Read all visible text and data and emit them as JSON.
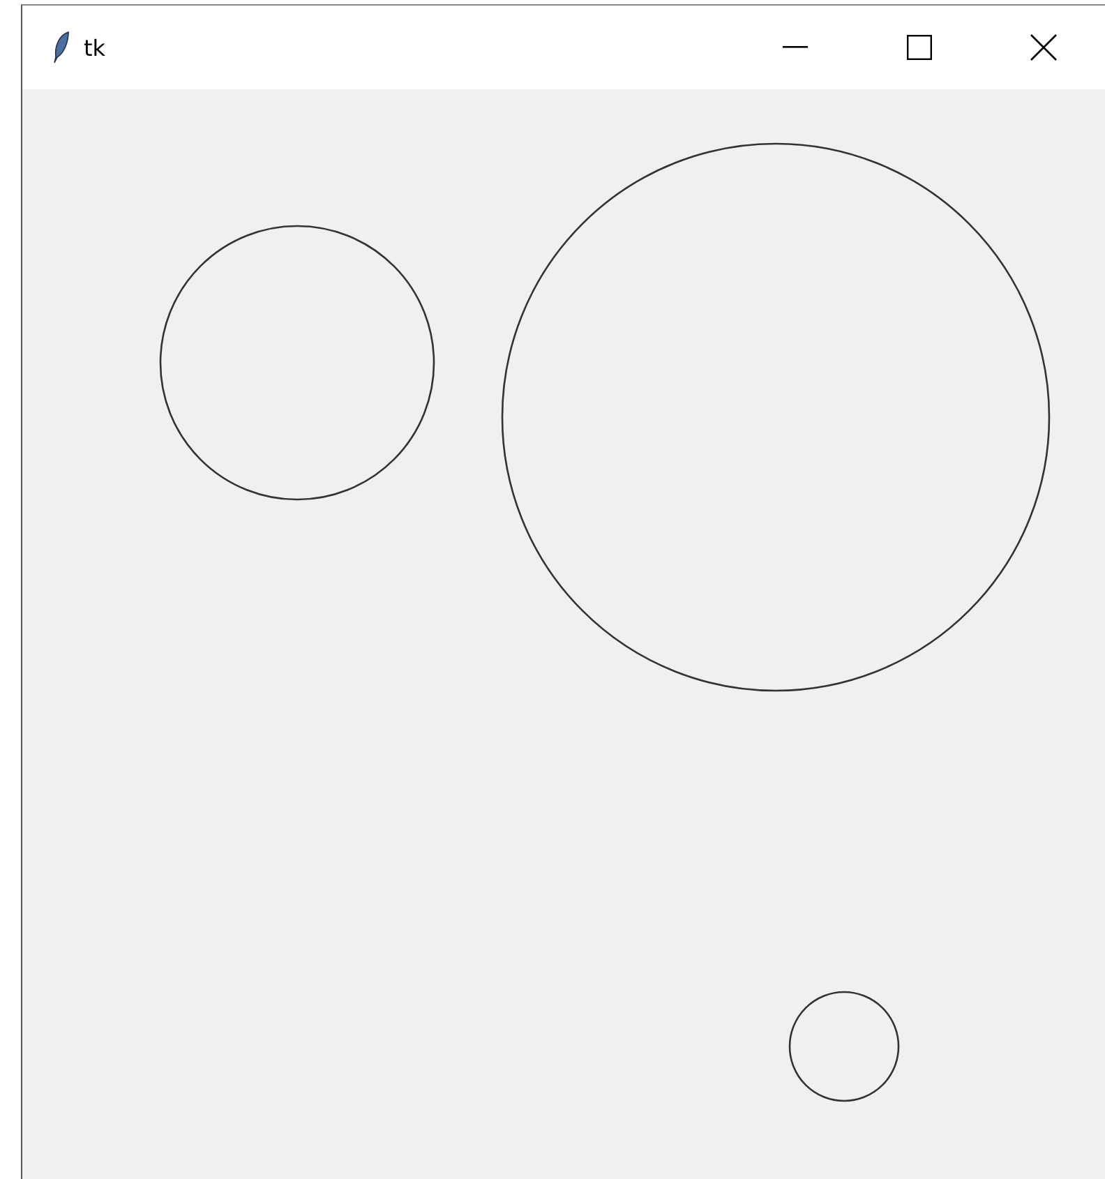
{
  "window": {
    "title": "tk"
  },
  "canvas": {
    "shapes": [
      {
        "kind": "circle"
      },
      {
        "kind": "circle"
      },
      {
        "kind": "circle"
      }
    ]
  }
}
